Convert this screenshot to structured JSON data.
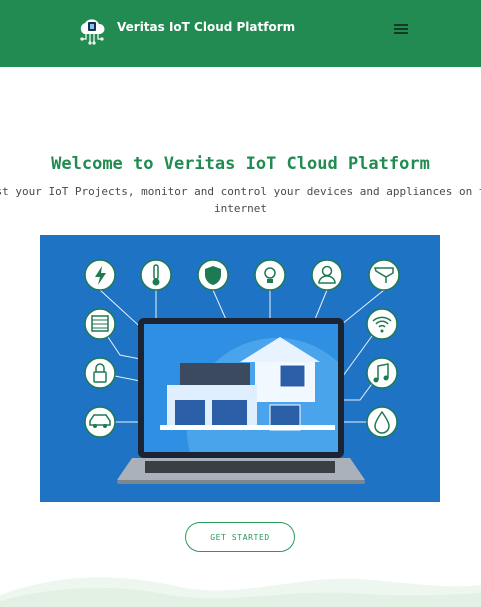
{
  "brand": {
    "name": "Veritas IoT Cloud Platform"
  },
  "hero": {
    "title": "Welcome to Veritas IoT Cloud Platform",
    "subtitle": "Test your IoT Projects, monitor and control your devices and appliances on the internet",
    "cta_label": "GET STARTED"
  },
  "colors": {
    "brand_green": "#218b52",
    "illustration_blue": "#1f73c4",
    "icon_green": "#1d7a52"
  },
  "illustration": {
    "icons": [
      "lightning-icon",
      "thermometer-icon",
      "shield-icon",
      "bulb-icon",
      "user-icon",
      "cctv-icon",
      "window-blinds-icon",
      "wifi-icon",
      "lock-icon",
      "music-icon",
      "car-icon",
      "water-drop-icon"
    ]
  }
}
